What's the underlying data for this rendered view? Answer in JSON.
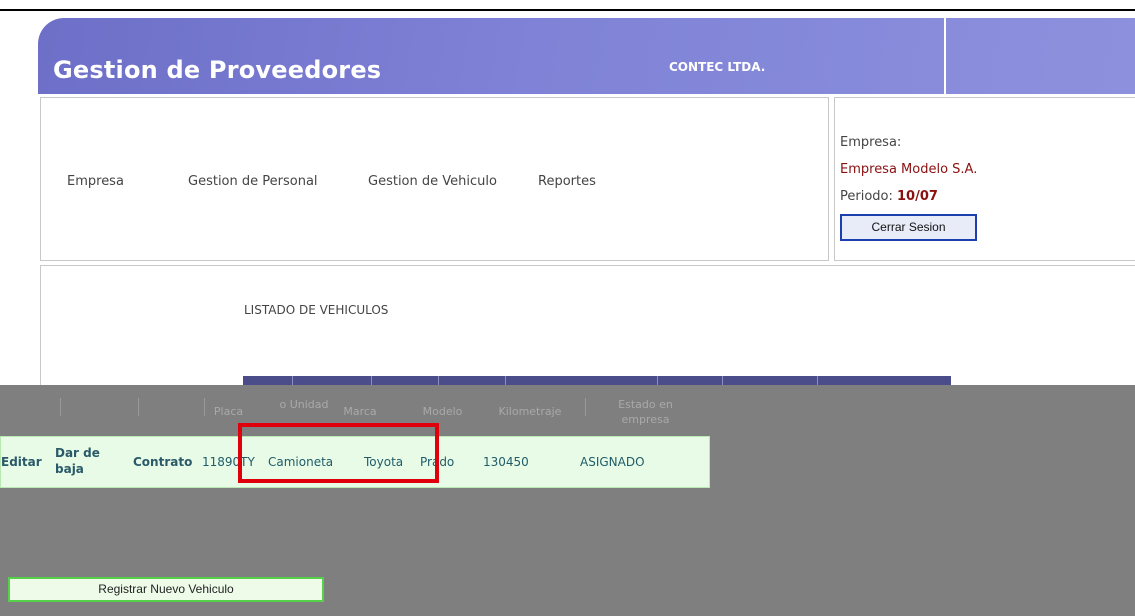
{
  "header": {
    "app_title": "Gestion de Proveedores",
    "company": "CONTEC LTDA."
  },
  "nav": {
    "items": [
      {
        "label": "Empresa"
      },
      {
        "label": "Gestion de Personal"
      },
      {
        "label": "Gestion de Vehiculo"
      },
      {
        "label": "Reportes"
      }
    ]
  },
  "session": {
    "company_label": "Empresa:",
    "company_name": "Empresa Modelo S.A.",
    "period_label": "Periodo:",
    "period_value": "10/07",
    "logout_label": "Cerrar Sesion"
  },
  "listing": {
    "title": "LISTADO DE VEHICULOS",
    "columns": [
      "Placa",
      "o Unidad",
      "Marca",
      "Modelo",
      "Kilometraje",
      "Estado en empresa"
    ],
    "rows": [
      {
        "edit": "Editar",
        "deactivate": "Dar de baja",
        "contract": "Contrato",
        "plate": "11890TY",
        "unit_type": "Camioneta",
        "brand": "Toyota",
        "model": "Prado",
        "mileage": "130450",
        "status": "ASIGNADO"
      }
    ]
  },
  "actions": {
    "register_label": "Registrar Nuevo Vehiculo"
  },
  "colors": {
    "header": "#7f82d6",
    "company_text": "#8b1010",
    "highlight": "#e0000b",
    "row_bg": "#e8fbe6",
    "register_border": "#55d24a"
  }
}
